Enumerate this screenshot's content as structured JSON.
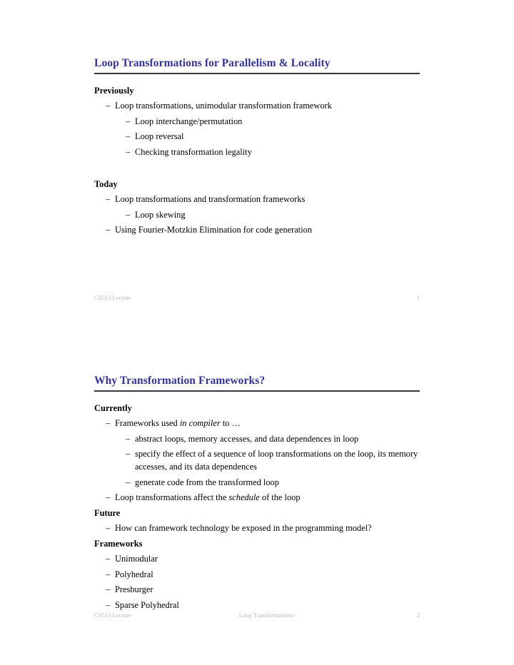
{
  "theme": {
    "title_color": "#333399",
    "rule_color": "#35353a",
    "footer_color": "#b9b9bd",
    "text_color": "#000000",
    "background": "#ffffff"
  },
  "slides": [
    {
      "title": "Loop Transformations for Parallelism & Locality",
      "sections": [
        {
          "heading": "Previously",
          "items": [
            {
              "level": 1,
              "text": "Loop transformations, unimodular transformation framework"
            },
            {
              "level": 2,
              "text": "Loop interchange/permutation"
            },
            {
              "level": 2,
              "text": "Loop reversal"
            },
            {
              "level": 2,
              "text": "Checking transformation legality"
            }
          ]
        },
        {
          "heading": "Today",
          "items": [
            {
              "level": 1,
              "text": "Loop transformations and transformation frameworks"
            },
            {
              "level": 2,
              "text": "Loop skewing"
            },
            {
              "level": 1,
              "text": "Using Fourier-Motzkin Elimination for code generation"
            }
          ]
        }
      ],
      "footer": {
        "left": "CS553 Lecture",
        "center": "",
        "right": "1"
      }
    },
    {
      "title": "Why Transformation Frameworks?",
      "sections": [
        {
          "heading": "Currently",
          "items": [
            {
              "level": 1,
              "text": "Frameworks used in compiler to …",
              "italic": "in compiler"
            },
            {
              "level": 2,
              "text": "abstract loops, memory accesses, and data dependences in loop"
            },
            {
              "level": 2,
              "text": "specify the effect of a sequence of loop transformations on the loop, its memory accesses, and its data dependences"
            },
            {
              "level": 2,
              "text": "generate code from the transformed loop"
            },
            {
              "level": 1,
              "text": "Loop transformations affect the schedule of the loop",
              "italic": "schedule"
            }
          ]
        },
        {
          "heading": "Future",
          "items": [
            {
              "level": 1,
              "text": "How can framework technology be exposed in the programming model?"
            }
          ]
        },
        {
          "heading": "Frameworks",
          "items": [
            {
              "level": 1,
              "text": "Unimodular"
            },
            {
              "level": 1,
              "text": "Polyhedral"
            },
            {
              "level": 1,
              "text": "Presburger"
            },
            {
              "level": 1,
              "text": "Sparse Polyhedral"
            }
          ]
        }
      ],
      "footer": {
        "left": "CS553 Lecture",
        "center": "Loop Transformations",
        "right": "2"
      }
    }
  ],
  "bullet_glyph": "–"
}
